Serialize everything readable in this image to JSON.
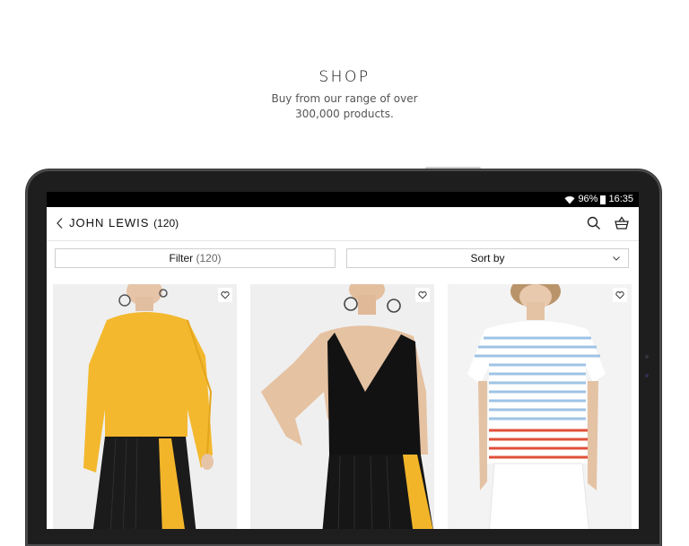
{
  "hero": {
    "title": "SHOP",
    "subtitle_line1": "Buy from our range of over",
    "subtitle_line2": "300,000 products."
  },
  "status_bar": {
    "battery": "96%",
    "time": "16:35"
  },
  "app_bar": {
    "title": "JOHN LEWIS",
    "count": "(120)"
  },
  "toolbar": {
    "filter_label": "Filter",
    "filter_count": "(120)",
    "sort_label": "Sort by"
  },
  "products": [
    {
      "name": "yellow-chiffon-top-pleated-skirt",
      "favourite": false
    },
    {
      "name": "black-v-neck-cami-dress",
      "favourite": false
    },
    {
      "name": "blue-striped-tshirt",
      "favourite": false
    }
  ],
  "icons": [
    "back-icon",
    "search-icon",
    "basket-icon",
    "chevron-down-icon",
    "heart-icon",
    "wifi-icon",
    "battery-icon"
  ],
  "colors": {
    "status_bar": "#000000",
    "device_frame": "#1e1e1f",
    "card_bg": "#f1f1f1",
    "border": "#cfcfcf"
  }
}
